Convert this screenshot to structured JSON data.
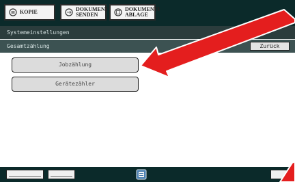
{
  "tabs": [
    {
      "icon": "copier-icon",
      "label": "KOPIE"
    },
    {
      "icon": "document-send-icon",
      "label": "DOKUMENT\nSENDEN"
    },
    {
      "icon": "document-archive-icon",
      "label": "DOKUMENTEN-\nABLAGE"
    }
  ],
  "header": {
    "title": "Systemeinstellungen",
    "subtitle": "Gesamtzählung",
    "back_label": "Zurück"
  },
  "menu": {
    "items": [
      {
        "label": "Jobzählung"
      },
      {
        "label": "Gerätezähler"
      }
    ]
  },
  "overlay": {
    "arrow_color": "#e41e1e"
  },
  "colors": {
    "tab_bar": "#0b2a2a",
    "title_bar": "#2b3c3c",
    "sub_bar": "#3c5252"
  }
}
